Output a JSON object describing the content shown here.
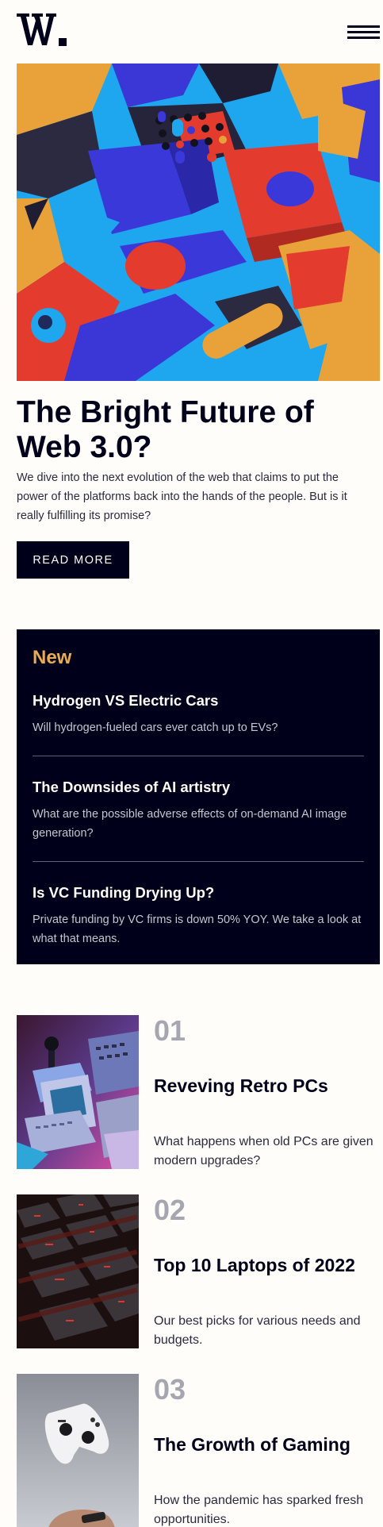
{
  "header": {
    "logo_text": "W.",
    "menu_icon": "hamburger-icon"
  },
  "hero": {
    "title": "The Bright Future of Web 3.0?",
    "description": "We dive into the next evolution of the web that claims to put the power of the platforms back into the hands of the people. But is it really fulfilling its promise?",
    "button_label": "READ MORE"
  },
  "new_section": {
    "heading": "New",
    "items": [
      {
        "title": "Hydrogen VS Electric Cars",
        "description": "Will hydrogen-fueled cars ever catch up to EVs?"
      },
      {
        "title": "The Downsides of AI artistry",
        "description": "What are the possible adverse effects of on-demand AI image generation?"
      },
      {
        "title": "Is VC Funding Drying Up?",
        "description": "Private funding by VC firms is down 50% YOY. We take a look at what that means."
      }
    ]
  },
  "articles": [
    {
      "number": "01",
      "title": "Reveving Retro PCs",
      "description": "What happens when old PCs are given modern upgrades?"
    },
    {
      "number": "02",
      "title": "Top 10 Laptops of 2022",
      "description": "Our best picks for various needs and budgets."
    },
    {
      "number": "03",
      "title": "The Growth of Gaming",
      "description": "How the pandemic has sparked fresh opportunities."
    }
  ],
  "colors": {
    "dark": "#00001a",
    "accent": "#e9ab53",
    "muted": "#a5a6b0",
    "background": "#fffdfa"
  }
}
